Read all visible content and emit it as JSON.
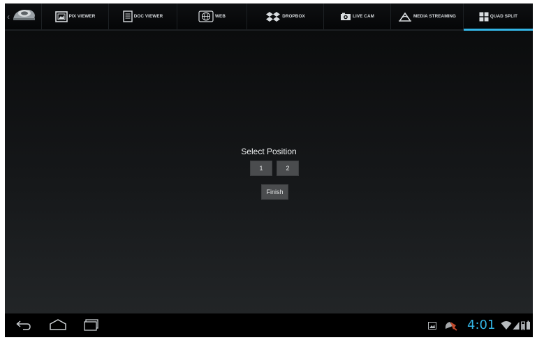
{
  "tabs": [
    {
      "label": "PIX VIEWER",
      "icon": "picture-frame-icon",
      "selected": false
    },
    {
      "label": "DOC VIEWER",
      "icon": "document-icon",
      "selected": false
    },
    {
      "label": "WEB",
      "icon": "globe-icon",
      "selected": false
    },
    {
      "label": "DROPBOX",
      "icon": "dropbox-icon",
      "selected": false
    },
    {
      "label": "LIVE CAM",
      "icon": "camera-icon",
      "selected": false
    },
    {
      "label": "MEDIA STREAMING",
      "icon": "media-streaming-icon",
      "selected": false
    },
    {
      "label": "QUAD SPLIT",
      "icon": "quad-split-icon",
      "selected": true
    }
  ],
  "dialog": {
    "title": "Select Position",
    "positions": [
      "1",
      "2"
    ],
    "finish_label": "Finish"
  },
  "system": {
    "clock": "4:01",
    "accent": "#33b5e5"
  }
}
